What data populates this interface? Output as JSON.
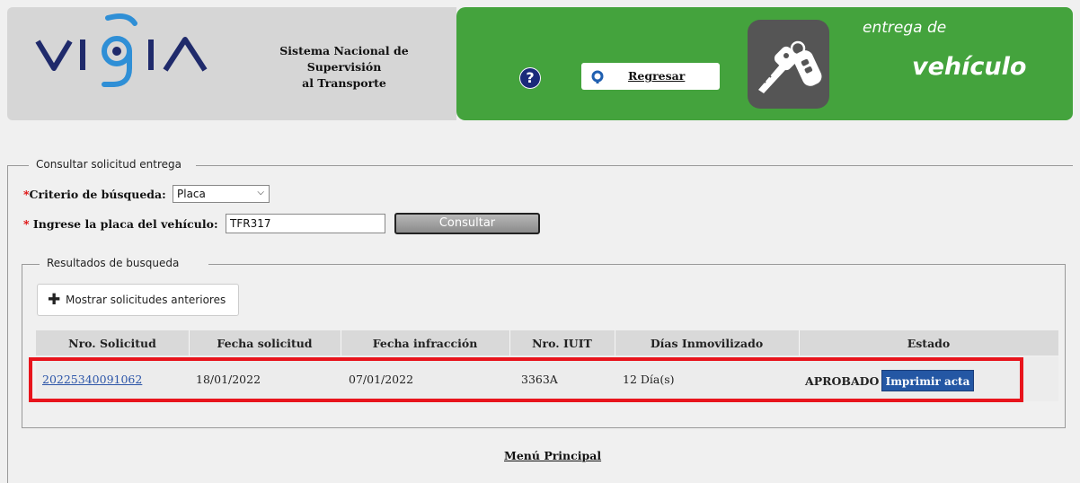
{
  "header": {
    "logo_text": "VIGIA",
    "system_title_line1": "Sistema Nacional de",
    "system_title_line2": "Supervisión",
    "system_title_line3": "al Transporte",
    "help_symbol": "?",
    "back_label": "Regresar",
    "service_small": "entrega de",
    "service_big": "vehículo",
    "left_bg": "#d6d6d6",
    "right_bg": "#44a33d"
  },
  "search": {
    "legend": "Consultar solicitud entrega",
    "required_mark": "*",
    "criteria_label": "Criterio de búsqueda:",
    "criteria_value": "Placa",
    "plate_label": "Ingrese la placa del vehículo:",
    "plate_value": "TFR317",
    "consult_button": "Consultar"
  },
  "results": {
    "legend": "Resultados de busqueda",
    "show_previous_label": "Mostrar solicitudes anteriores",
    "columns": [
      "Nro. Solicitud",
      "Fecha solicitud",
      "Fecha infracción",
      "Nro. IUIT",
      "Días Inmovilizado",
      "Estado"
    ],
    "rows": [
      {
        "nro_solicitud": "20225340091062",
        "fecha_solicitud": "18/01/2022",
        "fecha_infraccion": "07/01/2022",
        "nro_iuit": "3363A",
        "dias": "12 Día(s)",
        "estado": "APROBADO",
        "action": "Imprimir acta"
      }
    ],
    "highlight_color": "#e8141c",
    "action_color": "#2457a4"
  },
  "footer": {
    "menu_link": "Menú Principal"
  }
}
